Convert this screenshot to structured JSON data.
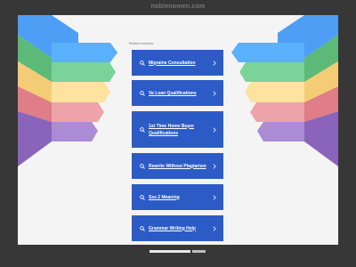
{
  "site": {
    "domain": "noblenomen.com"
  },
  "related": {
    "heading": "Related searches",
    "items": [
      {
        "label": "Migraine Consultation"
      },
      {
        "label": "Va Loan Qualifications"
      },
      {
        "label": "1st Time Home Buyer Qualifications"
      },
      {
        "label": "Rewrite Without Plagiarism"
      },
      {
        "label": "Sss 2 Meaning"
      },
      {
        "label": "Grammar Writing Help"
      }
    ]
  },
  "icons": {
    "search": "search-icon",
    "chevron": "chevron-right-icon"
  },
  "colors": {
    "background": "#373737",
    "page": "#f4f4f4",
    "result_button": "#2c5bc6",
    "wing_stripes": [
      "#4e9ef5",
      "#63c781",
      "#fbd989",
      "#e48e93",
      "#9774c5"
    ]
  }
}
